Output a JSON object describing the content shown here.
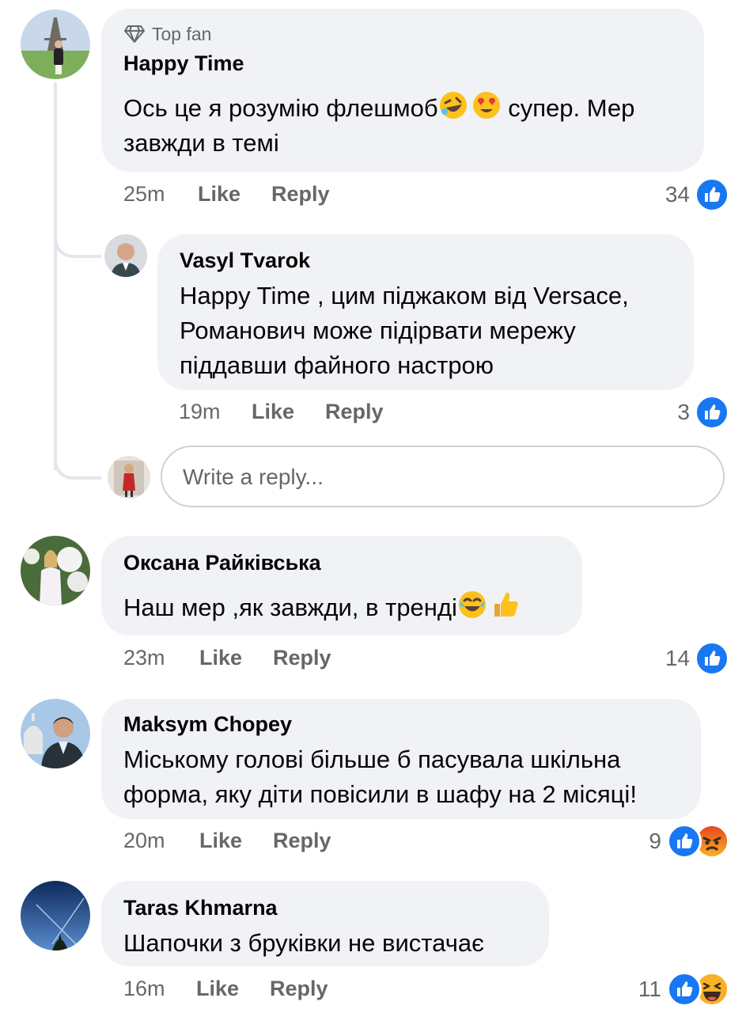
{
  "comments": [
    {
      "badge": "Top fan",
      "author": "Happy Time",
      "lines": [
        "Ось це я розумію флешмоб",
        "завжди в темі"
      ],
      "line1_after": " супер. Мер",
      "time": "25m",
      "like": "Like",
      "reply": "Reply",
      "count": "34",
      "reactions": [
        "like-icon"
      ]
    },
    {
      "author": "Vasyl Tvarok",
      "lines": [
        "Happy Time , цим піджаком від Versace,",
        "Романович може підірвати мережу",
        "піддавши файного настрою"
      ],
      "time": "19m",
      "like": "Like",
      "reply": "Reply",
      "count": "3",
      "reactions": [
        "like-icon"
      ]
    },
    {
      "author": "Оксана Райківська",
      "lines": [
        "Наш мер ,як завжди, в тренді"
      ],
      "time": "23m",
      "like": "Like",
      "reply": "Reply",
      "count": "14",
      "reactions": [
        "like-icon"
      ]
    },
    {
      "author": "Maksym Chopey",
      "lines": [
        "Міському голові більше б пасувала шкільна",
        "форма, яку діти повісили в шафу на 2 місяці!"
      ],
      "time": "20m",
      "like": "Like",
      "reply": "Reply",
      "count": "9",
      "reactions": [
        "like-icon",
        "angry-icon"
      ]
    },
    {
      "author": "Taras Khmarna",
      "lines": [
        "Шапочки з бруківки не вистачає"
      ],
      "time": "16m",
      "like": "Like",
      "reply": "Reply",
      "count": "11",
      "reactions": [
        "like-icon",
        "haha-icon"
      ]
    }
  ],
  "reply_input": {
    "placeholder": "Write a reply..."
  },
  "colors": {
    "like_blue": "#1877f2",
    "angry": "#f05b2a",
    "haha": "#f7b125",
    "bubble": "#f0f2f5",
    "meta": "#65676b"
  }
}
